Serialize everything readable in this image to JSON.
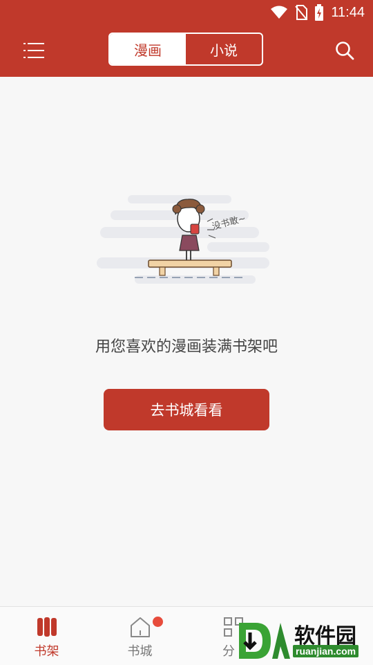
{
  "status_bar": {
    "time": "11:44"
  },
  "header": {
    "tabs": [
      {
        "label": "漫画",
        "active": true
      },
      {
        "label": "小说",
        "active": false
      }
    ]
  },
  "empty_state": {
    "illustration_caption": "没书敢~",
    "message": "用您喜欢的漫画装满书架吧",
    "cta_label": "去书城看看"
  },
  "bottom_nav": {
    "items": [
      {
        "label": "书架",
        "icon": "bookshelf-icon",
        "active": true
      },
      {
        "label": "书城",
        "icon": "home-icon",
        "active": false,
        "badge": true
      },
      {
        "label": "分",
        "icon": "category-icon",
        "active": false
      }
    ]
  },
  "watermark": {
    "title": "软件园",
    "subtitle": "ruanjian.com"
  },
  "colors": {
    "accent": "#c0392b",
    "badge": "#e74c3c",
    "background": "#f7f7f7"
  }
}
